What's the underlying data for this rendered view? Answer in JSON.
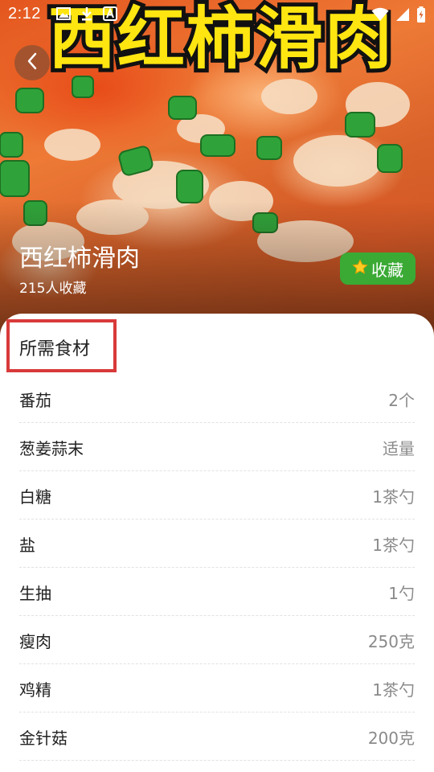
{
  "status_bar": {
    "time": "2:12",
    "left_icons": [
      "image-icon",
      "download-icon",
      "app-a-icon"
    ],
    "right_icons": [
      "wifi-icon",
      "signal-icon",
      "battery-charging-icon"
    ]
  },
  "hero": {
    "banner_title": "西红柿滑肉",
    "recipe_name": "西红柿滑肉",
    "favorites_count_text": "215人收藏",
    "favorite_button_label": "收藏",
    "favorite_icon": "star-icon",
    "back_icon": "chevron-left-icon"
  },
  "ingredients": {
    "section_title": "所需食材",
    "items": [
      {
        "name": "番茄",
        "amount": "2个"
      },
      {
        "name": "葱姜蒜末",
        "amount": "适量"
      },
      {
        "name": "白糖",
        "amount": "1茶勺"
      },
      {
        "name": "盐",
        "amount": "1茶勺"
      },
      {
        "name": "生抽",
        "amount": "1勺"
      },
      {
        "name": "瘦肉",
        "amount": "250克"
      },
      {
        "name": "鸡精",
        "amount": "1茶勺"
      },
      {
        "name": "金针菇",
        "amount": "200克"
      }
    ]
  },
  "colors": {
    "favorite_button": "#3aaa35",
    "highlight_border": "#d93a3a",
    "banner_text": "#ffe611",
    "amount_text": "#8a8a8a"
  }
}
